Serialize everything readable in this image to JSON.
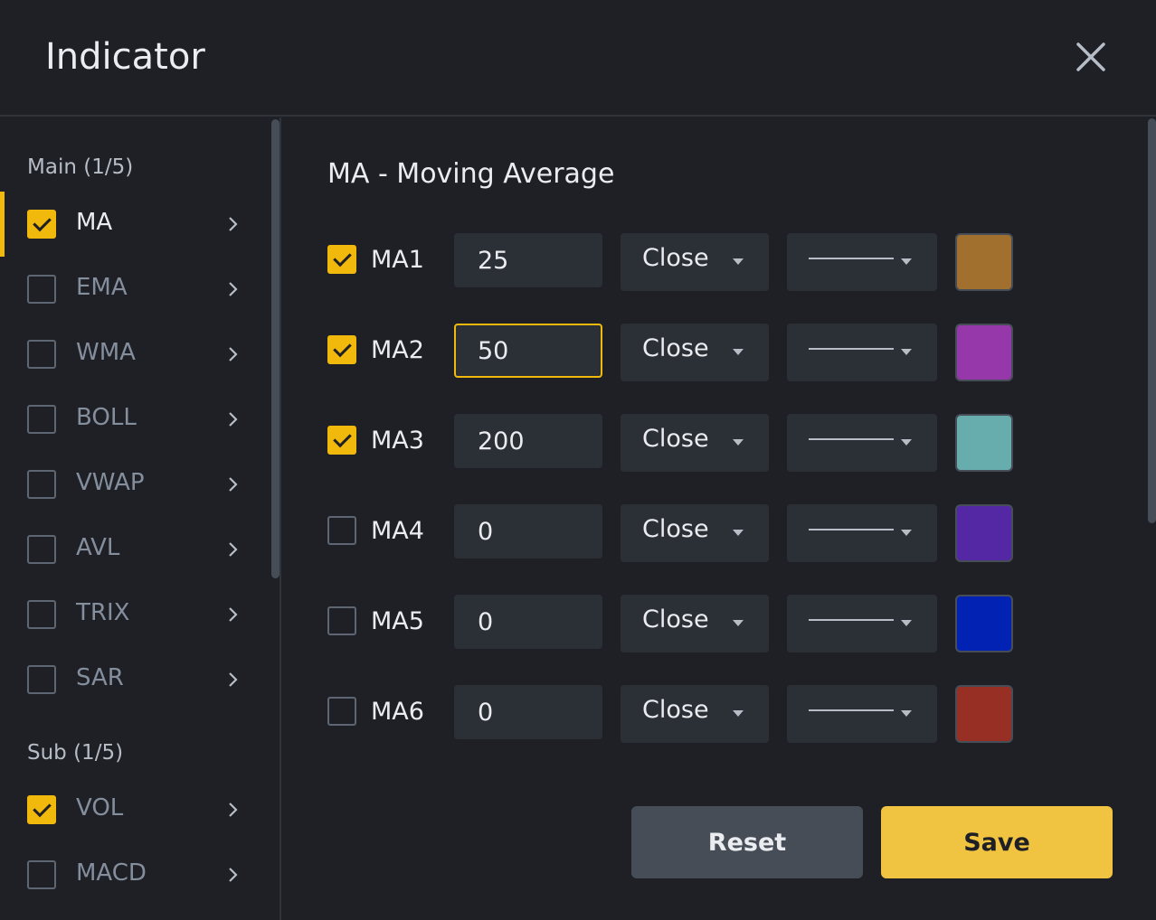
{
  "dialog": {
    "title": "Indicator"
  },
  "sidebar": {
    "main_label": "Main (1/5)",
    "main_items": [
      {
        "label": "MA",
        "checked": true,
        "active": true
      },
      {
        "label": "EMA",
        "checked": false
      },
      {
        "label": "WMA",
        "checked": false
      },
      {
        "label": "BOLL",
        "checked": false
      },
      {
        "label": "VWAP",
        "checked": false
      },
      {
        "label": "AVL",
        "checked": false
      },
      {
        "label": "TRIX",
        "checked": false
      },
      {
        "label": "SAR",
        "checked": false
      }
    ],
    "sub_label": "Sub (1/5)",
    "sub_items": [
      {
        "label": "VOL",
        "checked": true
      },
      {
        "label": "MACD",
        "checked": false
      }
    ]
  },
  "panel": {
    "title": "MA - Moving Average",
    "rows": [
      {
        "label": "MA1",
        "checked": true,
        "length": "25",
        "source": "Close",
        "color": "#a1702f"
      },
      {
        "label": "MA2",
        "checked": true,
        "length": "50",
        "source": "Close",
        "color": "#9638a9",
        "focused": true
      },
      {
        "label": "MA3",
        "checked": true,
        "length": "200",
        "source": "Close",
        "color": "#68adad"
      },
      {
        "label": "MA4",
        "checked": false,
        "length": "0",
        "source": "Close",
        "color": "#5427a4"
      },
      {
        "label": "MA5",
        "checked": false,
        "length": "0",
        "source": "Close",
        "color": "#0222b4"
      },
      {
        "label": "MA6",
        "checked": false,
        "length": "0",
        "source": "Close",
        "color": "#982f24"
      }
    ]
  },
  "buttons": {
    "reset": "Reset",
    "save": "Save"
  },
  "colors": {
    "accent": "#f0b90b",
    "background": "#1e2026",
    "control": "#2b2f36"
  }
}
